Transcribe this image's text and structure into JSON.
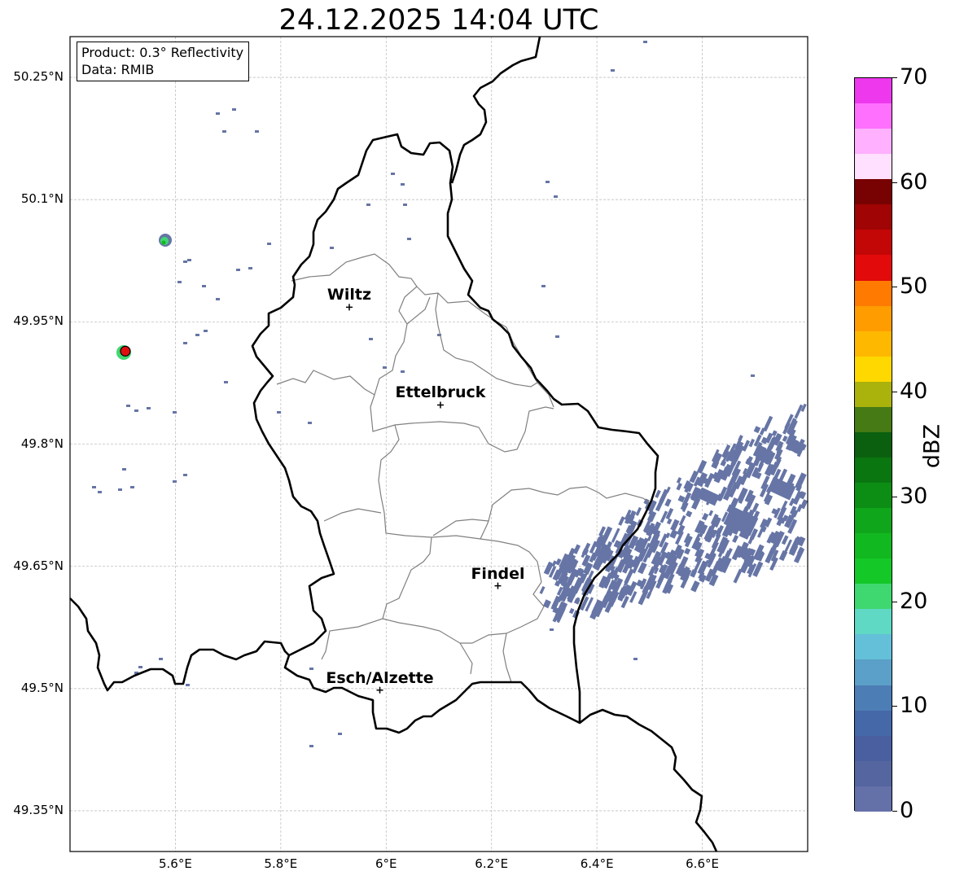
{
  "title": "24.12.2025 14:04 UTC",
  "info": {
    "product": "Product: 0.3° Reflectivity",
    "data": "Data: RMIB"
  },
  "axes": {
    "lon_ticks": [
      {
        "v": 5.6,
        "label": "5.6°E"
      },
      {
        "v": 5.8,
        "label": "5.8°E"
      },
      {
        "v": 6.0,
        "label": "6°E"
      },
      {
        "v": 6.2,
        "label": "6.2°E"
      },
      {
        "v": 6.4,
        "label": "6.4°E"
      },
      {
        "v": 6.6,
        "label": "6.6°E"
      }
    ],
    "lat_ticks": [
      {
        "v": 50.25,
        "label": "50.25°N"
      },
      {
        "v": 50.1,
        "label": "50.1°N"
      },
      {
        "v": 49.95,
        "label": "49.95°N"
      },
      {
        "v": 49.8,
        "label": "49.8°N"
      },
      {
        "v": 49.65,
        "label": "49.65°N"
      },
      {
        "v": 49.5,
        "label": "49.5°N"
      },
      {
        "v": 49.35,
        "label": "49.35°N"
      }
    ],
    "lon_range": [
      5.4,
      6.8
    ],
    "lat_range": [
      49.3,
      50.3
    ]
  },
  "cities": [
    {
      "name": "Wiltz",
      "lon": 5.93,
      "lat": 49.968
    },
    {
      "name": "Ettelbruck",
      "lon": 6.103,
      "lat": 49.848
    },
    {
      "name": "Findel",
      "lon": 6.212,
      "lat": 49.626
    },
    {
      "name": "Esch/Alzette",
      "lon": 5.988,
      "lat": 49.498
    }
  ],
  "radar_site": {
    "lon": 5.505,
    "lat": 49.914,
    "color": "#e01010"
  },
  "colorbar": {
    "label": "dBZ",
    "ticks": [
      {
        "v": 0,
        "label": "0"
      },
      {
        "v": 10,
        "label": "10"
      },
      {
        "v": 20,
        "label": "20"
      },
      {
        "v": 30,
        "label": "30"
      },
      {
        "v": 40,
        "label": "40"
      },
      {
        "v": 50,
        "label": "50"
      },
      {
        "v": 60,
        "label": "60"
      },
      {
        "v": 70,
        "label": "70"
      }
    ],
    "range": [
      0,
      70
    ],
    "colors": [
      "#6470a8",
      "#55659f",
      "#4a5fa0",
      "#4568a8",
      "#4d7db5",
      "#5aa0c8",
      "#63c0d8",
      "#5fd8c4",
      "#3fd870",
      "#14c828",
      "#12b81f",
      "#10a61b",
      "#0c8e14",
      "#0a7610",
      "#0a600e",
      "#457a14",
      "#aab20c",
      "#ffd800",
      "#ffb800",
      "#ff9c00",
      "#ff7a00",
      "#e20a0a",
      "#c30606",
      "#a00404",
      "#780202",
      "#ffe0ff",
      "#ffb0ff",
      "#ff70ff",
      "#ee38ee"
    ]
  },
  "colors": {
    "echo": "#6675a5",
    "echo_light_green": "#3fd870",
    "echo_green": "#12b81f"
  }
}
